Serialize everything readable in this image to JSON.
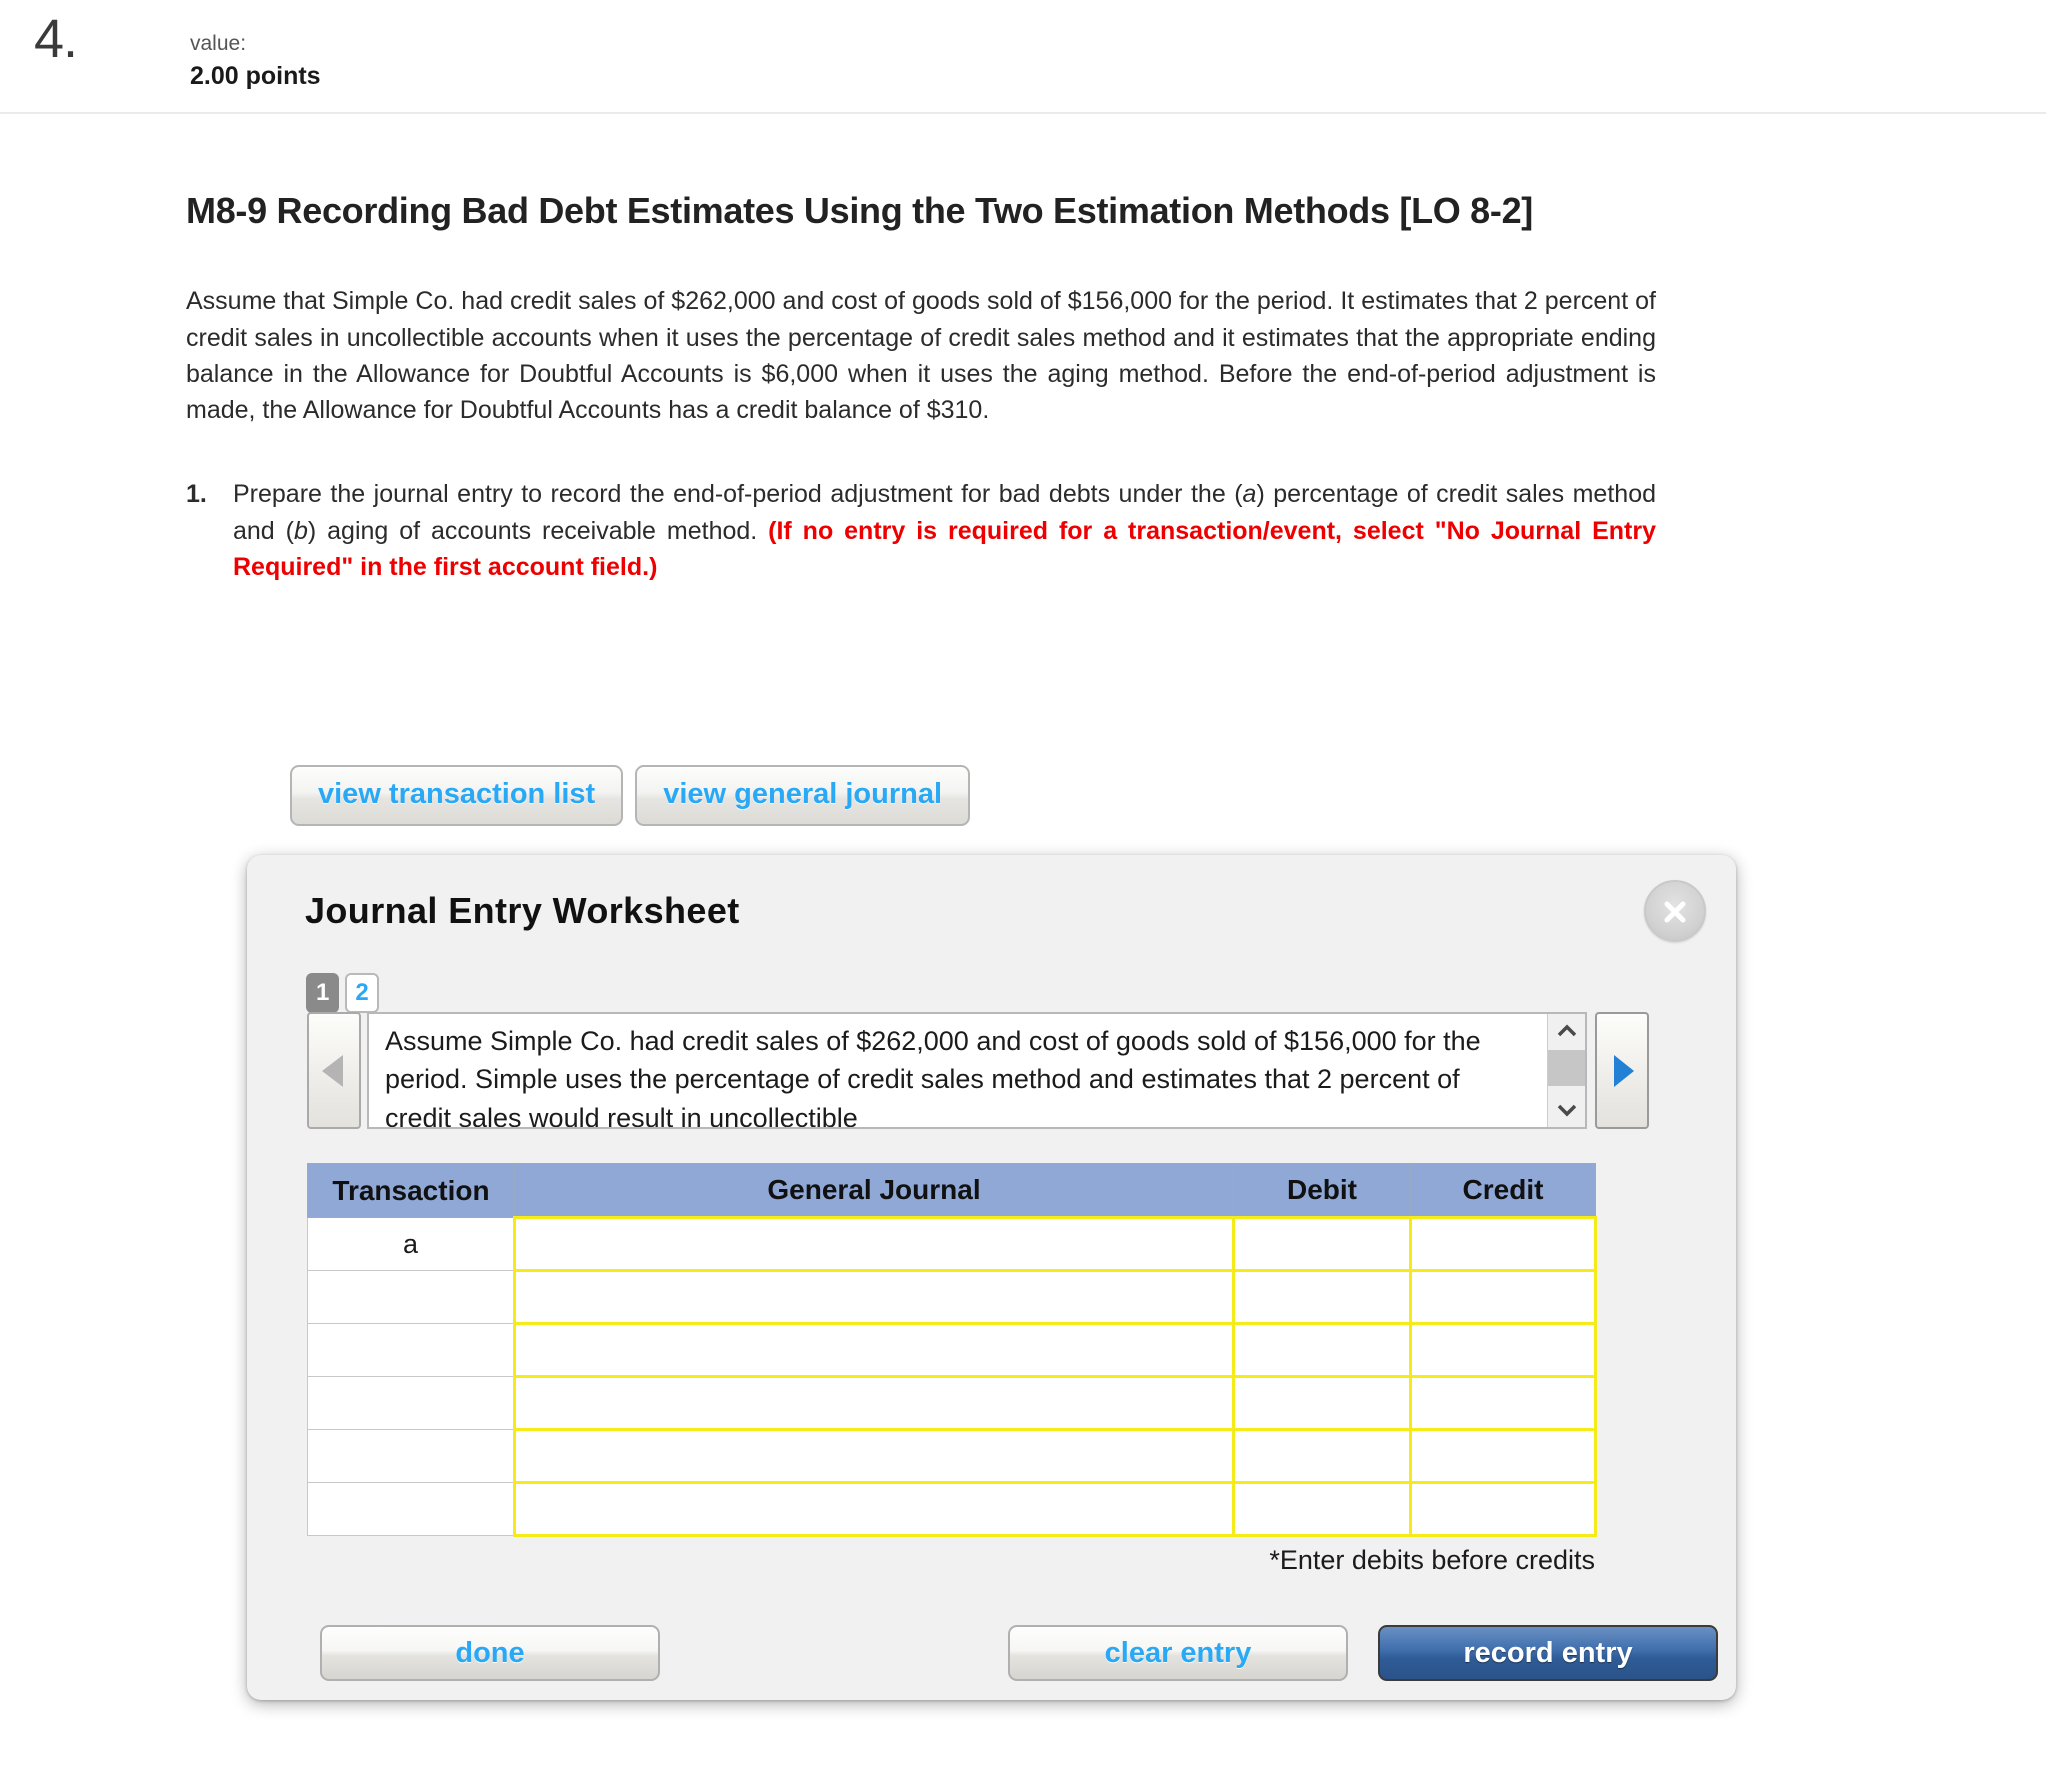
{
  "question": {
    "number": "4.",
    "value_label": "value:",
    "points": "2.00 points"
  },
  "exercise": {
    "title": "M8-9 Recording Bad Debt Estimates Using the Two Estimation Methods [LO 8-2]",
    "scenario": "Assume that Simple Co. had credit sales of $262,000 and cost of goods sold of $156,000 for the period. It estimates that 2 percent of credit sales in uncollectible accounts when it uses the percentage of credit sales method and it estimates that the appropriate ending balance in the Allowance for Doubtful Accounts is $6,000 when it uses the aging method. Before the end-of-period adjustment is made, the Allowance for Doubtful Accounts has a credit balance of $310.",
    "requirement": {
      "number": "1.",
      "text_part1": "Prepare the journal entry to record the end-of-period adjustment for bad debts under the (",
      "italic_a": "a",
      "text_part2": ") percentage of credit sales method and (",
      "italic_b": "b",
      "text_part3": ") aging of accounts receivable method. ",
      "red_text": "(If no entry is required for a transaction/event, select \"No Journal Entry Required\" in the first account field.)"
    }
  },
  "view_buttons": [
    {
      "label": "view transaction list",
      "name": "view-transaction-list-button"
    },
    {
      "label": "view general journal",
      "name": "view-general-journal-button"
    }
  ],
  "worksheet": {
    "title": "Journal Entry Worksheet",
    "close_icon": "close-icon",
    "tabs": [
      {
        "label": "1",
        "active": true
      },
      {
        "label": "2",
        "active": false
      }
    ],
    "prev_arrow": "triangle-left-icon",
    "next_arrow": "triangle-right-icon",
    "description": "Assume Simple Co. had credit sales of $262,000 and cost of goods sold of $156,000 for the period. Simple uses the percentage of credit sales method and estimates that 2 percent of credit sales would result in uncollectible",
    "scroll_up_icon": "chevron-up-icon",
    "scroll_down_icon": "chevron-down-icon",
    "table": {
      "columns": [
        "Transaction",
        "General Journal",
        "Debit",
        "Credit"
      ],
      "rows": [
        {
          "transaction": "a",
          "general_journal": "",
          "debit": "",
          "credit": ""
        },
        {
          "transaction": "",
          "general_journal": "",
          "debit": "",
          "credit": ""
        },
        {
          "transaction": "",
          "general_journal": "",
          "debit": "",
          "credit": ""
        },
        {
          "transaction": "",
          "general_journal": "",
          "debit": "",
          "credit": ""
        },
        {
          "transaction": "",
          "general_journal": "",
          "debit": "",
          "credit": ""
        },
        {
          "transaction": "",
          "general_journal": "",
          "debit": "",
          "credit": ""
        }
      ]
    },
    "note": "*Enter debits before credits",
    "buttons": {
      "done": "done",
      "clear": "clear entry",
      "record": "record entry"
    }
  },
  "colors": {
    "link_blue": "#29a9f5",
    "header_blue": "#8fa8d6",
    "cell_yellow": "#f5eb18",
    "record_blue": "#3e6eac",
    "alert_red": "#ee0000"
  }
}
